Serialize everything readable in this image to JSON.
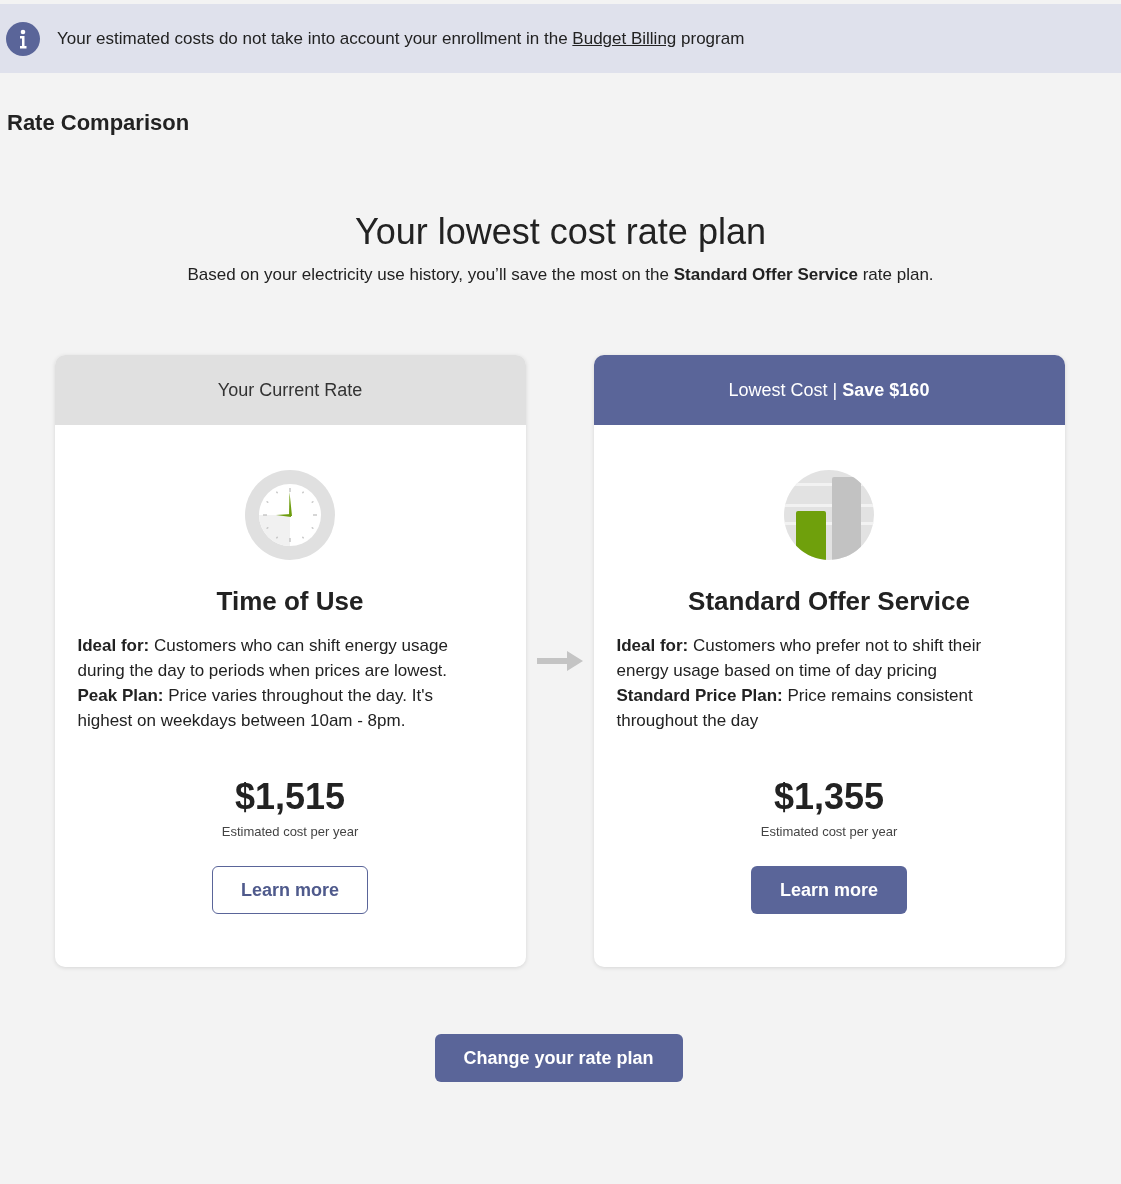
{
  "banner": {
    "text_before": "Your estimated costs do not take into account your enrollment in the",
    "link": "Budget Billing",
    "text_after": "program"
  },
  "page_title": "Rate Comparison",
  "headline": "Your lowest cost rate plan",
  "subheadline": "Based on your electricity use history, you’ll save the most on the **Standard Offer Service** rate plan.",
  "cards": [
    {
      "kind": "current",
      "header": "Your Current Rate",
      "plan_name": "Time of Use",
      "details": [
        "**Ideal for:** Customers who can shift energy usage during the day to periods when prices are lowest.",
        "**Peak Plan:** Price varies throughout the day. It's highest on weekdays between 10am - 8pm."
      ],
      "price": "$1,515",
      "price_note": "Estimated cost per year",
      "button": "Learn more"
    },
    {
      "kind": "recommended",
      "header": "Lowest Cost  | **Save $160**",
      "plan_name": "Standard Offer Service",
      "details": [
        "**Ideal for:** Customers who prefer not to shift their energy usage based on time of day pricing",
        "**Standard Price Plan:** Price remains consistent throughout the day"
      ],
      "price": "$1,355",
      "price_note": "Estimated cost per year",
      "button": "Learn more"
    }
  ],
  "action_button": "Change your rate plan"
}
